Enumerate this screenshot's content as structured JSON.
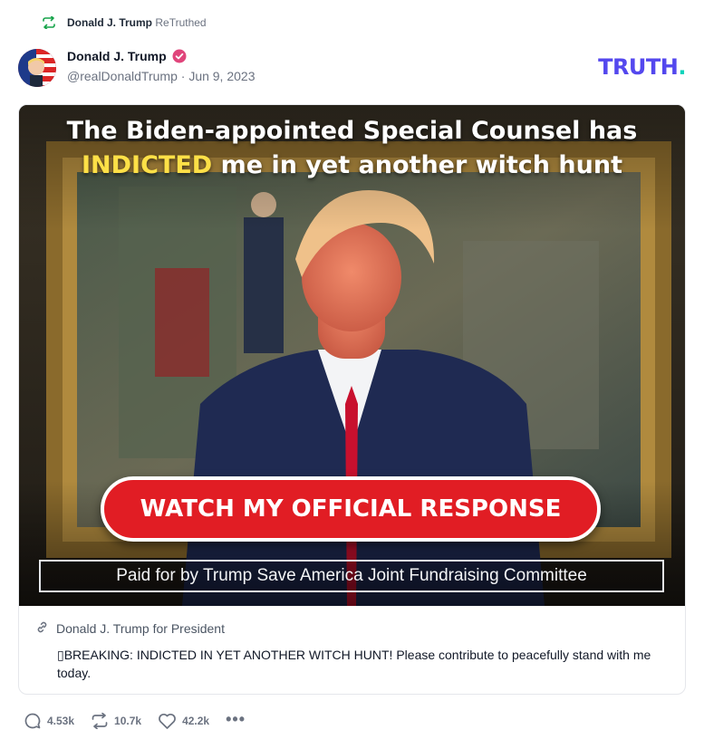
{
  "retruth": {
    "icon": "retruth-icon",
    "name": "Donald J. Trump",
    "label": "ReTruthed"
  },
  "author": {
    "name": "Donald J. Trump",
    "verified_icon": "verified-badge-icon",
    "handle": "@realDonaldTrump",
    "separator": "·",
    "date": "Jun 9, 2023"
  },
  "brand": {
    "text": "TRUTH",
    "dot": "."
  },
  "media": {
    "headline_line1": "The Biden-appointed Special Counsel has",
    "headline_highlight": "INDICTED",
    "headline_line2_rest": " me in yet another witch hunt",
    "cta_label": "WATCH MY OFFICIAL RESPONSE",
    "disclaimer": "Paid for by Trump Save America Joint Fundraising Committee"
  },
  "link": {
    "icon": "link-icon",
    "source": "Donald J. Trump for President",
    "description": "▯BREAKING: INDICTED IN YET ANOTHER WITCH HUNT! Please contribute to peacefully stand with me today."
  },
  "actions": {
    "replies": "4.53k",
    "retruths": "10.7k",
    "likes": "42.2k",
    "more": "•••"
  },
  "colors": {
    "brand": "#5448ee",
    "brand_dot": "#0dd3bb",
    "cta": "#e11d24",
    "highlight": "#fde047",
    "retruth_green": "#16a34a",
    "verified": "#e0457b"
  }
}
